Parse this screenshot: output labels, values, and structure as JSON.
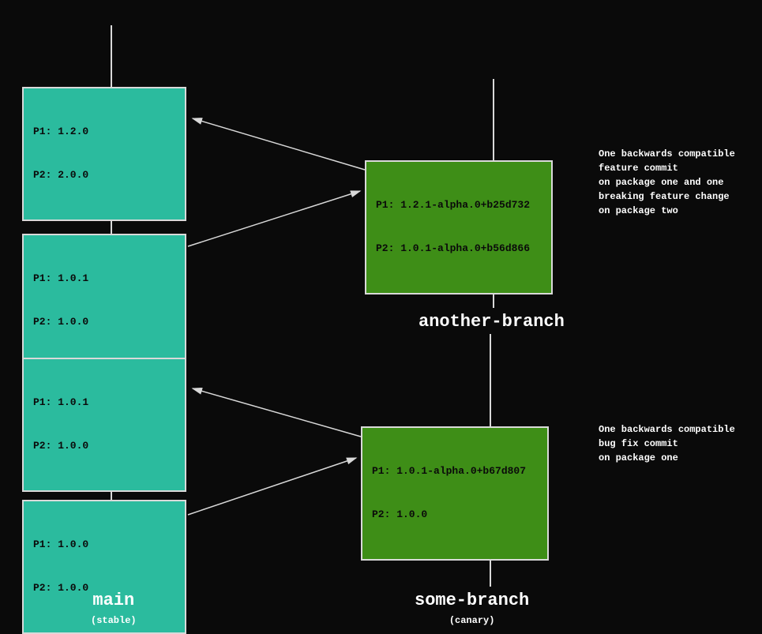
{
  "main": {
    "nodes": [
      {
        "p1": "P1: 1.2.0",
        "p2": "P2: 2.0.0"
      },
      {
        "p1": "P1: 1.0.1",
        "p2": "P2: 1.0.0"
      },
      {
        "p1": "P1: 1.0.1",
        "p2": "P2: 1.0.0"
      },
      {
        "p1": "P1: 1.0.0",
        "p2": "P2: 1.0.0"
      }
    ],
    "label": "main",
    "sublabel": "(stable)"
  },
  "another": {
    "node": {
      "p1": "P1: 1.2.1-alpha.0+b25d732",
      "p2": "P2: 1.0.1-alpha.0+b56d866"
    },
    "label": "another-branch",
    "annotation": "One backwards compatible\nfeature commit\non package one and one\nbreaking feature change\non package two"
  },
  "some": {
    "node": {
      "p1": "P1: 1.0.1-alpha.0+b67d807",
      "p2": "P2: 1.0.0"
    },
    "label": "some-branch",
    "sublabel": "(canary)",
    "annotation": "One backwards compatible\nbug fix commit\non package one"
  }
}
